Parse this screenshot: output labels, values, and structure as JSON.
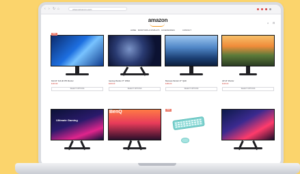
{
  "browser": {
    "address": "www.amazon.com",
    "nav_icons": [
      "back-arrow-icon",
      "forward-arrow-icon",
      "reload-icon",
      "home-icon"
    ]
  },
  "store": {
    "logo": "amazon",
    "header_icons": [
      "search-icon",
      "cart-icon"
    ],
    "nav_links": [
      "Home",
      "Monitors & Displays",
      "Accessories",
      "Contact"
    ]
  },
  "products": [
    {
      "title": "Dell 24\" Full HD IPS Monitor",
      "price": "$149.99",
      "button": "Select options",
      "sale": "Sale"
    },
    {
      "title": "Gaming Monitor 27\" 165Hz",
      "price": "$229.00",
      "button": "Select options"
    },
    {
      "title": "Business Monitor 27\" QHD",
      "price": "$189.00",
      "button": "Select options"
    },
    {
      "title": "HP 24\" Monitor",
      "price": "$129.00",
      "button": "Select options"
    },
    {
      "title": "",
      "price": "",
      "button": "",
      "overlay": "Ultimate Gaming"
    },
    {
      "title": "",
      "price": "",
      "button": "",
      "overlay": "BenQ"
    },
    {
      "title": "",
      "price": "",
      "button": "",
      "sale": "Sale"
    },
    {
      "title": "",
      "price": "",
      "button": ""
    }
  ],
  "colors": {
    "background": "#fbd46c",
    "accent": "#f29a24",
    "sale": "#ec7b6a"
  }
}
